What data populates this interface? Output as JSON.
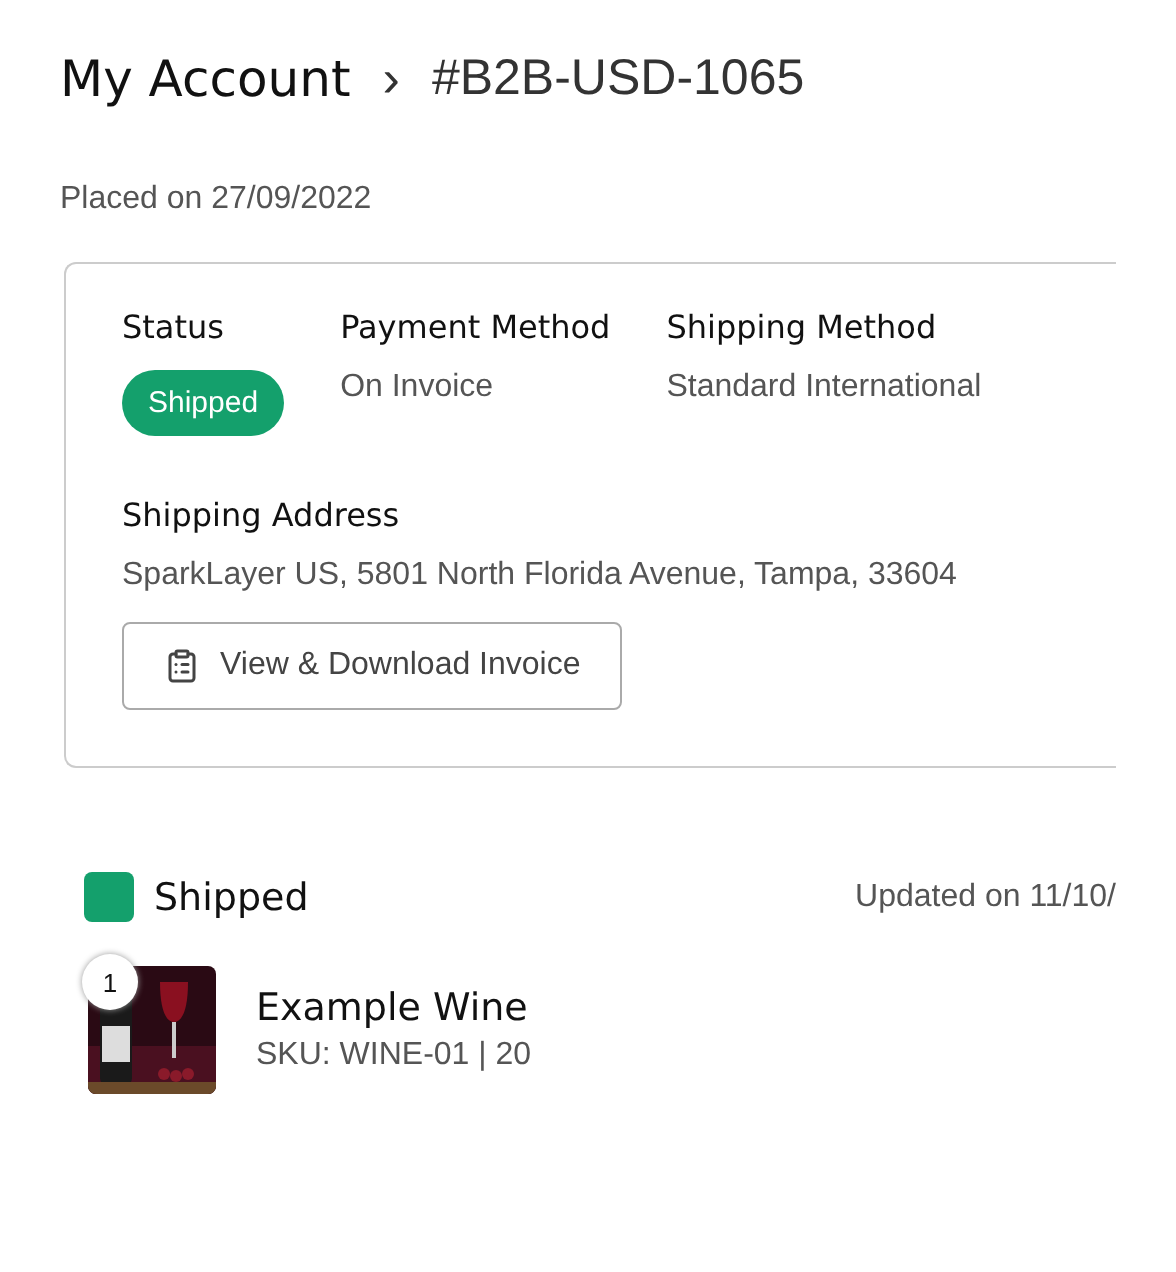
{
  "breadcrumb": {
    "parent": "My Account",
    "separator": "›",
    "current": "#B2B-USD-1065"
  },
  "placed": "Placed on 27/09/2022",
  "details": [
    {
      "label": "Status",
      "value": "Shipped",
      "kind": "badge"
    },
    {
      "label": "Payment Method",
      "value": "On Invoice",
      "kind": "text"
    },
    {
      "label": "Shipping Method",
      "value": "Standard International",
      "kind": "text"
    }
  ],
  "address": {
    "label": "Shipping Address",
    "value": "SparkLayer US, 5801 North Florida Avenue, Tampa, 33604"
  },
  "invoice_button": "View & Download Invoice",
  "shipment": {
    "status": "Shipped",
    "updated": "Updated on 11/10/",
    "items": [
      {
        "quantity": "1",
        "name": "Example Wine",
        "sku": "SKU: WINE-01 | 20",
        "kind": "picture"
      }
    ]
  }
}
